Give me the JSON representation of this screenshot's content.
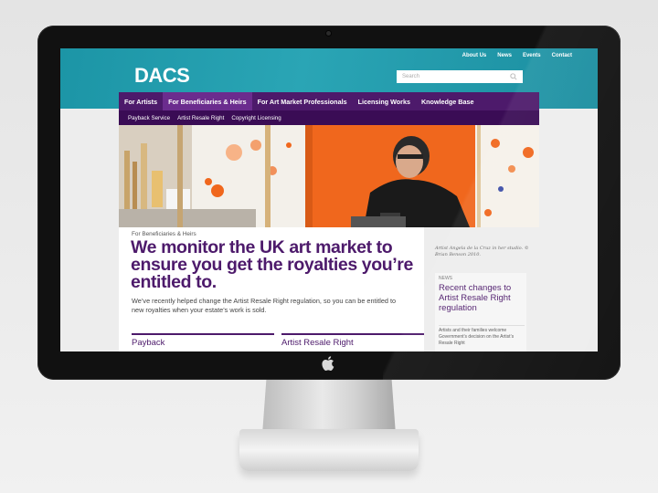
{
  "site": {
    "logo": "DACS",
    "util_nav": [
      "About Us",
      "News",
      "Events",
      "Contact"
    ],
    "search_placeholder": "Search",
    "main_nav": [
      {
        "label": "For Artists",
        "active": false
      },
      {
        "label": "For Beneficiaries & Heirs",
        "active": true
      },
      {
        "label": "For Art Market Professionals",
        "active": false
      },
      {
        "label": "Licensing Works",
        "active": false
      },
      {
        "label": "Knowledge Base",
        "active": false
      }
    ],
    "sub_nav": [
      "Payback Service",
      "Artist Resale Right",
      "Copyright Licensing"
    ],
    "caption": "Artist Angela de la Cruz in her studio. © Brian Benson 2010.",
    "eyebrow": "For Beneficiaries & Heirs",
    "headline": "We monitor the UK art market to ensure you get the royalties you’re entitled to.",
    "intro": "We’ve recently helped change the Artist Resale Right regulation, so you can be entitled to new royalties when your estate’s work is sold.",
    "columns": [
      "Payback",
      "Artist Resale Right"
    ],
    "sidebar": {
      "label": "NEWS",
      "title": "Recent changes to Artist Resale Right regulation",
      "text": "Artists and their families welcome Government’s decision on the Artist’s Resale Right"
    }
  },
  "colors": {
    "header_teal": "#2aa5b5",
    "nav_purple": "#4d1a6b",
    "subnav_purple": "#3a0c55",
    "headline_purple": "#4d1a6b",
    "hero_orange": "#f0671d"
  }
}
